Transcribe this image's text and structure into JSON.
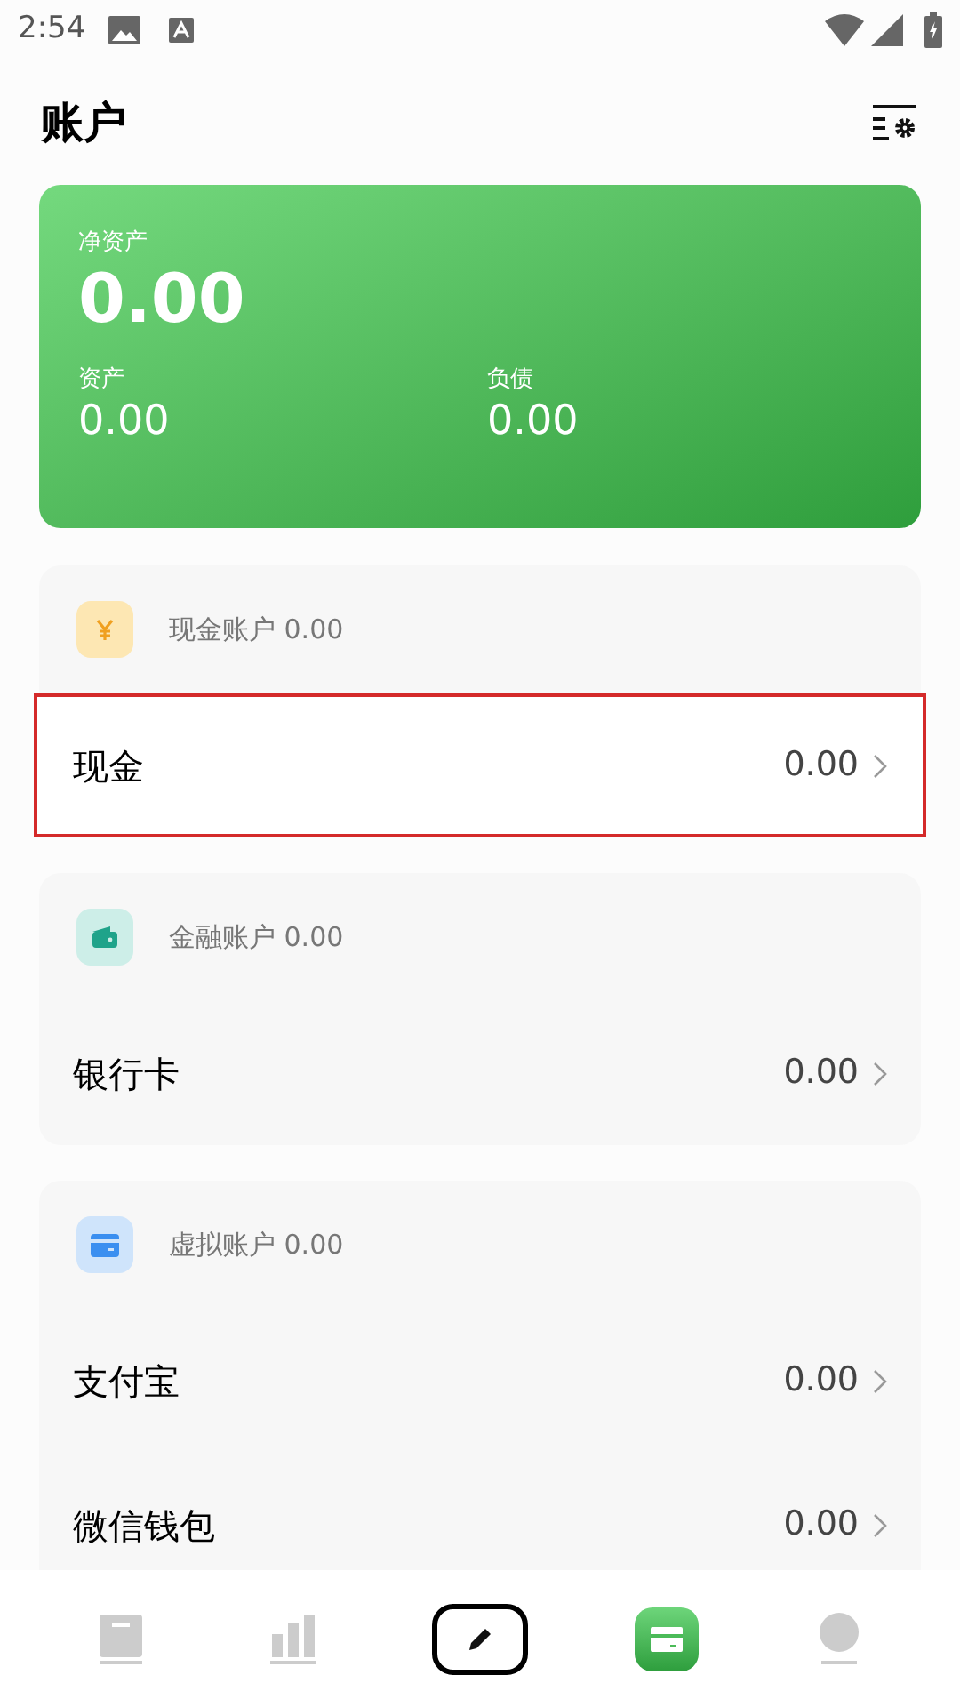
{
  "status_bar": {
    "time": "2:54"
  },
  "header": {
    "title": "账户"
  },
  "summary": {
    "net_label": "净资产",
    "net_value": "0.00",
    "assets_label": "资产",
    "assets_value": "0.00",
    "liabilities_label": "负债",
    "liabilities_value": "0.00"
  },
  "groups": [
    {
      "kind": "cash",
      "title": "现金账户 0.00",
      "accounts": [
        {
          "name": "现金",
          "amount": "0.00",
          "selected": true
        }
      ]
    },
    {
      "kind": "finance",
      "title": "金融账户 0.00",
      "accounts": [
        {
          "name": "银行卡",
          "amount": "0.00",
          "selected": false
        }
      ]
    },
    {
      "kind": "virtual",
      "title": "虚拟账户 0.00",
      "accounts": [
        {
          "name": "支付宝",
          "amount": "0.00",
          "selected": false
        },
        {
          "name": "微信钱包",
          "amount": "0.00",
          "selected": false
        }
      ]
    }
  ],
  "nav": [
    {
      "kind": "book",
      "selected": false
    },
    {
      "kind": "chart",
      "selected": false
    },
    {
      "kind": "compose",
      "selected": false
    },
    {
      "kind": "accounts",
      "selected": true
    },
    {
      "kind": "profile",
      "selected": false
    }
  ]
}
